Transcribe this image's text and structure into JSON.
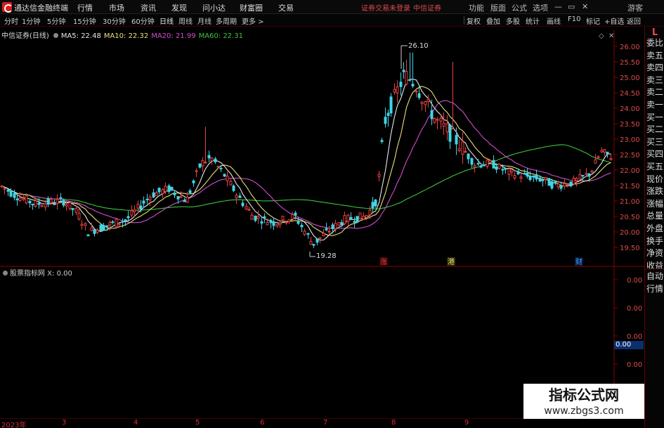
{
  "app": {
    "title": "通达信金融终端"
  },
  "menu": [
    "行情",
    "市场",
    "资讯",
    "发现",
    "问小达",
    "财富圈",
    "交易"
  ],
  "login": {
    "status": "证券交易未登录",
    "broker": "中信证券"
  },
  "window_buttons": [
    "功能",
    "版面",
    "公式",
    "选项",
    "游客"
  ],
  "periods": [
    "分时",
    "1分钟",
    "5分钟",
    "15分钟",
    "30分钟",
    "60分钟",
    "日线",
    "周线",
    "月线",
    "多周期",
    "更多 >"
  ],
  "active_period": "日线",
  "toolbar": [
    "复权",
    "叠加",
    "多股",
    "统计",
    "画线",
    "F10",
    "标记",
    "+自选",
    "返回"
  ],
  "stock": {
    "name_period": "中信证券(日线)"
  },
  "ma": [
    {
      "label": "MA5: 22.48",
      "color": "#e8e8e8"
    },
    {
      "label": "MA10: 22.32",
      "color": "#e8e07a"
    },
    {
      "label": "MA20: 21.99",
      "color": "#d24cd2"
    },
    {
      "label": "MA60: 22.31",
      "color": "#3cc43c"
    }
  ],
  "annotations": {
    "high": "26.10",
    "low": "19.28"
  },
  "event_markers": [
    {
      "label": "涨",
      "color": "#e04a4a"
    },
    {
      "label": "港",
      "color": "#e8e07a"
    },
    {
      "label": "财",
      "color": "#4aa0ff"
    }
  ],
  "colors": {
    "up": "#e84040",
    "down": "#40d4e4"
  },
  "right_panel": {
    "letter": "L",
    "tabs": [
      "委比",
      "卖五",
      "卖四",
      "卖三",
      "卖二",
      "卖一",
      "买一",
      "买二",
      "买三",
      "买四",
      "买五",
      "现价",
      "涨跌",
      "涨幅",
      "总量",
      "外盘",
      "换手",
      "净资",
      "收益"
    ],
    "tabs2": [
      "自动",
      "行情"
    ]
  },
  "sub_chart": {
    "legend": "股票指标网 X: 0.00",
    "current": "0.00"
  },
  "watermark": {
    "line1": "指标公式网",
    "line2": "www.zbgs3.com"
  },
  "time_axis": [
    "2023年",
    "3",
    "4",
    "5",
    "6",
    "7",
    "8",
    "9"
  ],
  "chart_data": {
    "type": "candlestick",
    "ylim": [
      19.3,
      26.4
    ],
    "yticks": [
      "26.00",
      "25.50",
      "25.00",
      "24.50",
      "24.00",
      "23.50",
      "23.00",
      "22.50",
      "22.00",
      "21.50",
      "21.00",
      "20.50",
      "20.00",
      "19.50"
    ],
    "sub_yticks": [
      "0.00",
      "0.00",
      "0.00",
      "0.00",
      "0.00"
    ]
  }
}
